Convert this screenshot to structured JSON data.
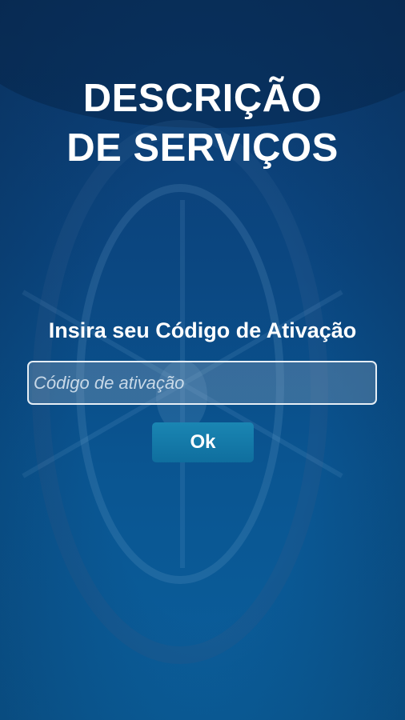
{
  "header": {
    "title_line1": "DESCRIÇÃO",
    "title_line2": "DE SERVIÇOS"
  },
  "activation": {
    "prompt": "Insira seu Código de Ativação",
    "input_value": "",
    "input_placeholder": "Código de ativação",
    "submit_label": "Ok"
  },
  "colors": {
    "background": "#0b4680",
    "button": "#1480ad",
    "text": "#ffffff"
  }
}
